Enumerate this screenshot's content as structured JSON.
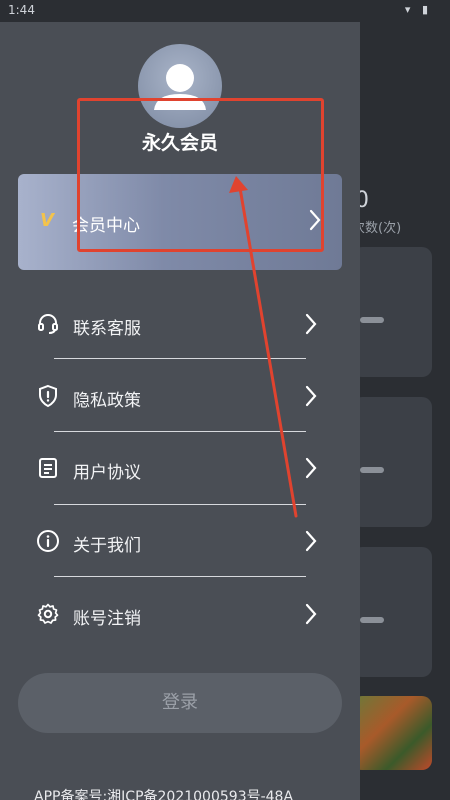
{
  "status_bar": {
    "time": "1:44",
    "icons": "▾ ▮"
  },
  "background_app": {
    "count": "0",
    "count_label": "次数(次)"
  },
  "drawer": {
    "username": "永久会员",
    "vip": {
      "badge": "V",
      "label": "会员中心"
    },
    "menu": [
      {
        "icon": "headset-icon",
        "label": "联系客服"
      },
      {
        "icon": "shield-icon",
        "label": "隐私政策"
      },
      {
        "icon": "document-icon",
        "label": "用户协议"
      },
      {
        "icon": "info-icon",
        "label": "关于我们"
      },
      {
        "icon": "settings-icon",
        "label": "账号注销"
      }
    ],
    "login_label": "登录",
    "footer": "APP备案号:湘ICP备2021000593号-48A"
  },
  "colors": {
    "drawer_bg": "#4a4e55",
    "vip_badge": "#f3c34b",
    "annotation": "#e0432f"
  }
}
